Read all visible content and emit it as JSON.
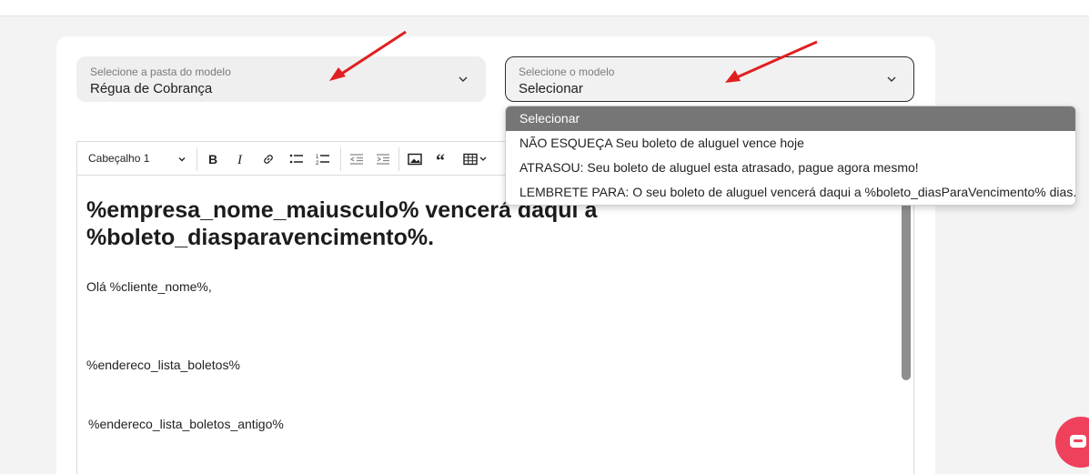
{
  "form": {
    "folder_select": {
      "label": "Selecione a pasta do modelo",
      "value": "Régua de Cobrança"
    },
    "model_select": {
      "label": "Selecione o modelo",
      "value": "Selecionar"
    }
  },
  "dropdown": {
    "options": [
      {
        "label": "Selecionar",
        "selected": true
      },
      {
        "label": "NÃO ESQUEÇA Seu boleto de aluguel vence hoje",
        "selected": false
      },
      {
        "label": "ATRASOU: Seu boleto de aluguel esta atrasado, pague agora mesmo!",
        "selected": false
      },
      {
        "label": "LEMBRETE PARA: O seu boleto de aluguel vencerá daqui a %boleto_diasParaVencimento% dias.",
        "selected": false
      }
    ]
  },
  "editor": {
    "toolbar": {
      "heading_value": "Cabeçalho 1",
      "buttons": [
        "bold-icon",
        "italic-icon",
        "link-icon",
        "bullet-list-icon",
        "numbered-list-icon",
        "outdent-icon",
        "indent-icon",
        "image-icon",
        "quote-icon",
        "table-icon"
      ]
    },
    "heading": "%empresa_nome_maiusculo% vencerá daqui a %boleto_diasparavencimento%.",
    "paragraphs": [
      "Olá %cliente_nome%,",
      "%endereco_lista_boletos%",
      "%endereco_lista_boletos_antigo%"
    ]
  },
  "colors": {
    "annotation_arrow": "#e02020",
    "chat_button": "#f0415c",
    "selected_option_bg": "#767676"
  }
}
